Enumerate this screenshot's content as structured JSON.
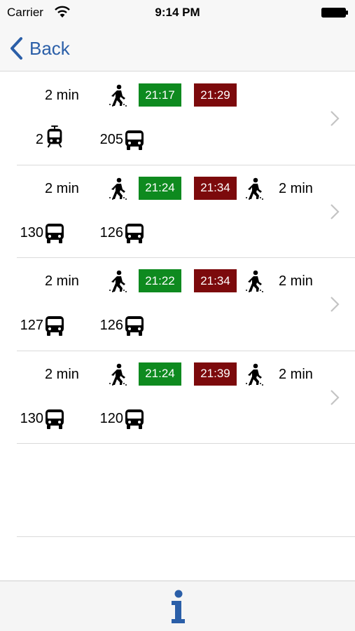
{
  "status_bar": {
    "carrier": "Carrier",
    "time": "9:14 PM",
    "wifi_icon": "wifi-icon",
    "battery_icon": "battery-icon"
  },
  "nav": {
    "back_label": "Back",
    "back_icon": "chevron-left-icon"
  },
  "colors": {
    "departure": "#0e8a1f",
    "arrival": "#7c0a0c",
    "tint": "#2b5fa8"
  },
  "routes": [
    {
      "walk_before": "2 min",
      "departure": "21:17",
      "arrival": "21:29",
      "walk_after": "",
      "legs": [
        {
          "line": "2",
          "vehicle": "tram-icon"
        },
        {
          "line": "205",
          "vehicle": "bus-icon"
        }
      ]
    },
    {
      "walk_before": "2 min",
      "departure": "21:24",
      "arrival": "21:34",
      "walk_after": "2 min",
      "legs": [
        {
          "line": "130",
          "vehicle": "bus-icon"
        },
        {
          "line": "126",
          "vehicle": "bus-icon"
        }
      ]
    },
    {
      "walk_before": "2 min",
      "departure": "21:22",
      "arrival": "21:34",
      "walk_after": "2 min",
      "legs": [
        {
          "line": "127",
          "vehicle": "bus-icon"
        },
        {
          "line": "126",
          "vehicle": "bus-icon"
        }
      ]
    },
    {
      "walk_before": "2 min",
      "departure": "21:24",
      "arrival": "21:39",
      "walk_after": "2 min",
      "legs": [
        {
          "line": "130",
          "vehicle": "bus-icon"
        },
        {
          "line": "120",
          "vehicle": "bus-icon"
        }
      ]
    }
  ],
  "tab_bar": {
    "info_icon": "info-icon"
  }
}
